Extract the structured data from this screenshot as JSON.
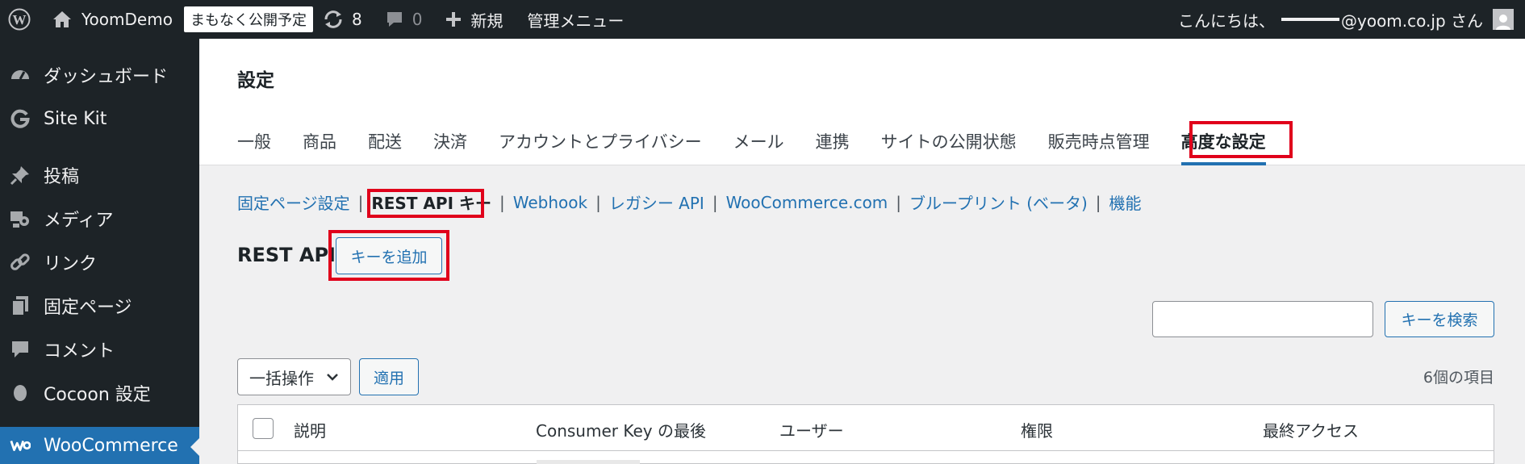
{
  "adminbar": {
    "site_name": "YoomDemo",
    "badge": "まもなく公開予定",
    "updates_count": "8",
    "comments_count": "0",
    "new_label": "新規",
    "admin_menu": "管理メニュー",
    "greeting": "こんにちは、",
    "email_suffix": "@yoom.co.jp さん"
  },
  "sidebar": {
    "items": [
      {
        "label": "ダッシュボード",
        "icon": "dashboard-icon"
      },
      {
        "label": "Site Kit",
        "icon": "google-g-icon"
      },
      {
        "label": "投稿",
        "icon": "pushpin-icon"
      },
      {
        "label": "メディア",
        "icon": "media-icon"
      },
      {
        "label": "リンク",
        "icon": "link-icon"
      },
      {
        "label": "固定ページ",
        "icon": "pages-icon"
      },
      {
        "label": "コメント",
        "icon": "comment-icon"
      },
      {
        "label": "Cocoon 設定",
        "icon": "cocoon-icon"
      },
      {
        "label": "WooCommerce",
        "icon": "woocommerce-icon"
      }
    ]
  },
  "header": {
    "title": "設定",
    "tabs": [
      "一般",
      "商品",
      "配送",
      "決済",
      "アカウントとプライバシー",
      "メール",
      "連携",
      "サイトの公開状態",
      "販売時点管理",
      "高度な設定"
    ],
    "current_tab": "高度な設定"
  },
  "subnav": {
    "items": [
      "固定ページ設定",
      "REST API キー",
      "Webhook",
      "レガシー API",
      "WooCommerce.com",
      "ブループリント (ベータ)",
      "機能"
    ],
    "current": "REST API キー"
  },
  "section": {
    "title": "REST API",
    "add_key_label": "キーを追加"
  },
  "search": {
    "value": "",
    "button_label": "キーを検索"
  },
  "bulk": {
    "selected": "一括操作",
    "apply_label": "適用"
  },
  "items_count": "6個の項目",
  "table": {
    "columns": [
      "説明",
      "Consumer Key の最後",
      "ユーザー",
      "権限",
      "最終アクセス"
    ]
  },
  "colors": {
    "accent": "#2271b1",
    "adminbar_bg": "#1d2327",
    "highlight": "#e0001b"
  }
}
